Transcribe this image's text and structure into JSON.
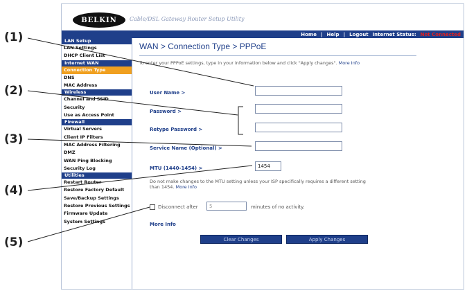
{
  "header": {
    "brand": "BELKIN",
    "app_title": "Cable/DSL Gateway Router Setup Utility",
    "nav": {
      "home": "Home",
      "help": "Help",
      "logout": "Logout",
      "status_label": "Internet Status:",
      "status_value": "Not Connected"
    }
  },
  "sidebar": {
    "sections": [
      {
        "head": "LAN Setup",
        "items": [
          "LAN Settings",
          "DHCP Client List"
        ]
      },
      {
        "head": "Internet WAN",
        "items": [
          "Connection Type",
          "DNS",
          "MAC Address"
        ]
      },
      {
        "head": "Wireless",
        "items": [
          "Channel and SSID",
          "Security",
          "Use as Access Point"
        ]
      },
      {
        "head": "Firewall",
        "items": [
          "Virtual Servers",
          "Client IP Filters",
          "MAC Address Filtering",
          "DMZ",
          "WAN Ping Blocking",
          "Security Log"
        ]
      },
      {
        "head": "Utilities",
        "items": [
          "Restart Router",
          "Restore Factory Default",
          "Save/Backup Settings",
          "Restore Previous Settings",
          "Firmware Update",
          "System Settings"
        ]
      }
    ],
    "active_item": "Connection Type"
  },
  "main": {
    "title": "WAN > Connection Type > PPPoE",
    "intro": "To enter your PPPoE settings, type in your information below and click \"Apply changes\".",
    "intro_link": "More Info",
    "fields": {
      "user_name": {
        "label": "User Name >",
        "value": ""
      },
      "password": {
        "label": "Password >",
        "value": ""
      },
      "retype_password": {
        "label": "Retype Password >",
        "value": ""
      },
      "service_name": {
        "label": "Service Name (Optional) >",
        "value": ""
      },
      "mtu": {
        "label": "MTU (1440-1454) >",
        "value": "1454"
      }
    },
    "mtu_note": "Do not make changes to the MTU setting unless your ISP specifically requires a different setting than 1454.",
    "mtu_note_link": "More Info",
    "disconnect": {
      "label_before": "Disconnect after",
      "value": "5",
      "label_after": "minutes of no activity."
    },
    "more_info": "More Info",
    "buttons": {
      "clear": "Clear Changes",
      "apply": "Apply Changes"
    }
  },
  "callouts": [
    "(1)",
    "(2)",
    "(3)",
    "(4)",
    "(5)"
  ]
}
